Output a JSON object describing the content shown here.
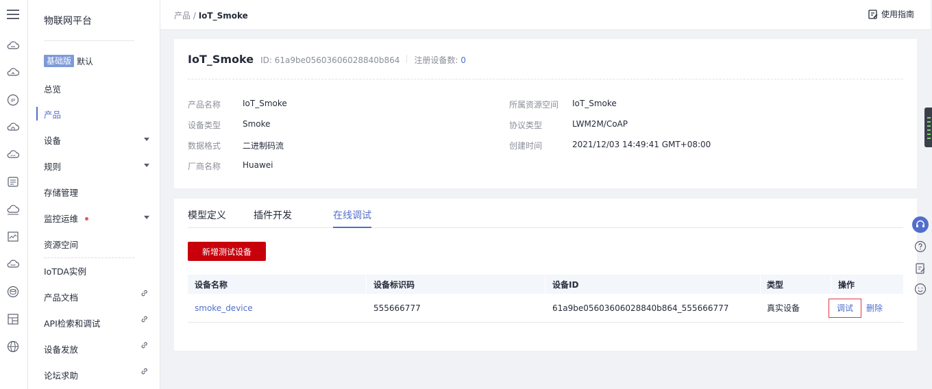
{
  "nav": {
    "brand": "物联网平台",
    "edition_badge": "基础版",
    "edition_name": "默认",
    "items": [
      {
        "label": "总览"
      },
      {
        "label": "产品"
      },
      {
        "label": "设备"
      },
      {
        "label": "规则"
      },
      {
        "label": "存储管理"
      },
      {
        "label": "监控运维"
      },
      {
        "label": "资源空间"
      },
      {
        "label": "IoTDA实例"
      },
      {
        "label": "产品文档"
      },
      {
        "label": "API检索和调试"
      },
      {
        "label": "设备发放"
      },
      {
        "label": "论坛求助"
      }
    ]
  },
  "header": {
    "breadcrumb_parent": "产品",
    "breadcrumb_sep": " / ",
    "breadcrumb_current": "IoT_Smoke",
    "guide_label": "使用指南"
  },
  "product": {
    "name": "IoT_Smoke",
    "id_label": "ID: 61a9be05603606028840b864",
    "registered_label": "注册设备数:",
    "registered_count": "0",
    "fields_left": [
      {
        "key": "产品名称",
        "value": "IoT_Smoke"
      },
      {
        "key": "设备类型",
        "value": "Smoke"
      },
      {
        "key": "数据格式",
        "value": "二进制码流"
      },
      {
        "key": "厂商名称",
        "value": "Huawei"
      }
    ],
    "fields_right": [
      {
        "key": "所属资源空间",
        "value": "IoT_Smoke"
      },
      {
        "key": "协议类型",
        "value": "LWM2M/CoAP"
      },
      {
        "key": "创建时间",
        "value": "2021/12/03 14:49:41 GMT+08:00"
      }
    ]
  },
  "tabs": [
    {
      "label": "模型定义"
    },
    {
      "label": "插件开发"
    },
    {
      "label": "在线调试"
    }
  ],
  "add_button_label": "新增测试设备",
  "table": {
    "columns": [
      "设备名称",
      "设备标识码",
      "设备ID",
      "类型",
      "操作"
    ],
    "rows": [
      {
        "name": "smoke_device",
        "identifier": "555666777",
        "device_id": "61a9be05603606028840b864_555666777",
        "type": "真实设备",
        "op_debug": "调试",
        "op_delete": "删除"
      }
    ]
  },
  "colors": {
    "accent": "#526ecc",
    "primary_button": "#c7000b",
    "badge": "#7d9ad8"
  }
}
